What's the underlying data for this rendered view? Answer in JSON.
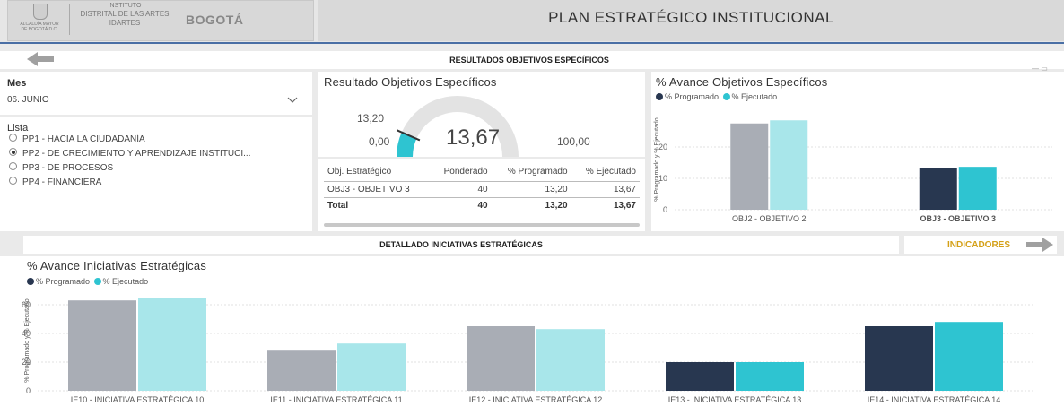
{
  "header": {
    "logo_text_1": "INSTITUTO",
    "logo_text_2": "DISTRITAL DE LAS ARTES",
    "logo_text_3": "IDARTES",
    "logo_brand": "BOGOTÁ",
    "logo_small": "ALCALDÍA MAYOR DE BOGOTÁ D.C.",
    "title": "PLAN ESTRATÉGICO INSTITUCIONAL"
  },
  "colors": {
    "programado_dark": "#283750",
    "programado_gray": "#a9adb5",
    "ejecutado_teal": "#2ec4d1",
    "ejecutado_light": "#a8e6ea",
    "accent_yellow": "#d4a017",
    "header_line": "#4a6fa5"
  },
  "section_top": {
    "label": "RESULTADOS OBJETIVOS ESPECÍFICOS",
    "back_icon": "arrow-left-icon"
  },
  "filters": {
    "mes_label": "Mes",
    "mes_value": "06. JUNIO",
    "lista_label": "Lista",
    "lista_items": [
      {
        "label": "PP1 - HACIA LA CIUDADANÍA",
        "selected": false
      },
      {
        "label": "PP2 - DE CRECIMIENTO Y APRENDIZAJE INSTITUCI...",
        "selected": true
      },
      {
        "label": "PP3 - DE PROCESOS",
        "selected": false
      },
      {
        "label": "PP4 - FINANCIERA",
        "selected": false
      }
    ]
  },
  "gauge": {
    "title": "Resultado Objetivos Específicos",
    "value": "13,67",
    "min": "0,00",
    "max": "100,00",
    "target": "13,20",
    "value_num": 13.67,
    "target_num": 13.2,
    "max_num": 100
  },
  "obj_table": {
    "headers": [
      "Obj. Estratégico",
      "Ponderado",
      "% Programado",
      "% Ejecutado"
    ],
    "rows": [
      [
        "OBJ3 - OBJETIVO 3",
        "40",
        "13,20",
        "13,67"
      ]
    ],
    "total": [
      "Total",
      "40",
      "13,20",
      "13,67"
    ]
  },
  "chart_objetivos": {
    "title": "% Avance Objetivos Específicos",
    "legend": [
      "% Programado",
      "% Ejecutado"
    ],
    "ylabel": "% Programado y % Ejecutado"
  },
  "section_bottom": {
    "label": "DETALLADO INICIATIVAS ESTRATÉGICAS",
    "indicadores_label": "INDICADORES",
    "forward_icon": "arrow-right-icon"
  },
  "chart_iniciativas": {
    "title": "% Avance Iniciativas Estratégicas",
    "legend": [
      "% Programado",
      "% Ejecutado"
    ],
    "ylabel": "% Programado y % Ejecutado"
  },
  "chart_data": [
    {
      "type": "bar",
      "title": "% Avance Objetivos Específicos",
      "xlabel": "",
      "ylabel": "% Programado y % Ejecutado",
      "categories": [
        "OBJ2 - OBJETIVO 2",
        "OBJ3 - OBJETIVO 3"
      ],
      "series": [
        {
          "name": "% Programado",
          "values": [
            27.5,
            13.2
          ]
        },
        {
          "name": "% Ejecutado",
          "values": [
            28.5,
            13.67
          ]
        }
      ],
      "yticks": [
        0,
        10,
        20
      ],
      "ylim": [
        0,
        32
      ],
      "highlighted_category": "OBJ3 - OBJETIVO 3",
      "legend_position": "top-left",
      "grid": true
    },
    {
      "type": "bar",
      "title": "% Avance Iniciativas Estratégicas",
      "xlabel": "",
      "ylabel": "% Programado y % Ejecutado",
      "categories": [
        "IE10 - INICIATIVA ESTRATÉGICA 10",
        "IE11 - INICIATIVA ESTRATÉGICA 11",
        "IE12 - INICIATIVA ESTRATÉGICA 12",
        "IE13 - INICIATIVA ESTRATÉGICA 13",
        "IE14 - INICIATIVA ESTRATÉGICA 14"
      ],
      "series": [
        {
          "name": "% Programado",
          "values": [
            63,
            28,
            45,
            20,
            45
          ]
        },
        {
          "name": "% Ejecutado",
          "values": [
            65,
            33,
            43,
            20,
            48
          ]
        }
      ],
      "highlighted_categories": [
        "IE13 - INICIATIVA ESTRATÉGICA 13",
        "IE14 - INICIATIVA ESTRATÉGICA 14"
      ],
      "yticks": [
        0,
        20,
        40,
        60
      ],
      "ylim": [
        0,
        70
      ],
      "legend_position": "top-left",
      "grid": true
    }
  ]
}
